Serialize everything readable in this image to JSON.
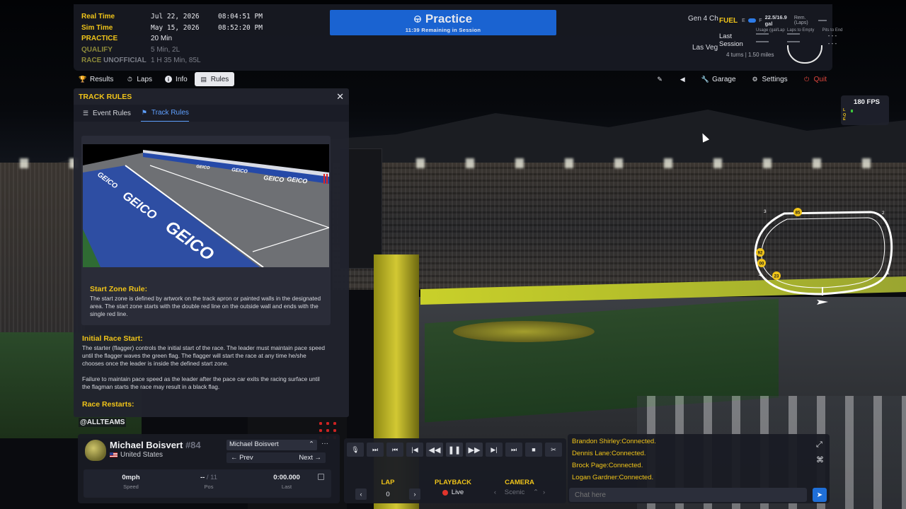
{
  "header": {
    "clock": [
      {
        "label": "Real Time",
        "date": "Jul 22, 2026",
        "time": "08:04:51 PM"
      },
      {
        "label": "Sim Time",
        "date": "May 15, 2026",
        "time": "08:52:20 PM"
      }
    ],
    "sessions": [
      {
        "label": "PRACTICE",
        "value": "20 Min"
      },
      {
        "label": "QUALIFY",
        "value": "5 Min, 2L"
      },
      {
        "label": "RACE",
        "tag": "UNOFFICIAL",
        "value": "1 H 35 Min, 85L"
      }
    ],
    "session_title": "Practice",
    "session_remaining": "11:39 Remaining in Session",
    "track_series": "Gen 4 Ch",
    "track_name": "Las Veg",
    "turns": "4 turns",
    "length": "1.50 miles",
    "fuel": {
      "label": "FUEL",
      "e": "E",
      "f": "F",
      "value": "22.5/16.9 gal",
      "rem_label": "Rem. (Laps)",
      "cols": [
        "Usage (gal/Lap",
        "Laps to Empty",
        "Pits to End"
      ],
      "rows": [
        {
          "name": "Last",
          "pits": "- - -"
        },
        {
          "name": "Session",
          "pits": "- - -"
        }
      ]
    }
  },
  "nav": {
    "left": [
      {
        "label": "Results",
        "icon": "trophy-icon"
      },
      {
        "label": "Laps",
        "icon": "stopwatch-icon"
      },
      {
        "label": "Info",
        "icon": "info-icon"
      },
      {
        "label": "Rules",
        "icon": "document-icon",
        "active": true
      }
    ],
    "right": {
      "garage": "Garage",
      "settings": "Settings",
      "quit": "Quit"
    }
  },
  "rules_panel": {
    "title": "TRACK RULES",
    "tabs": [
      "Event Rules",
      "Track Rules"
    ],
    "active_tab": "Track Rules",
    "image_signage": "GEICO",
    "start_zone": {
      "heading": "Start Zone Rule:",
      "text": "The start zone is defined by artwork on the track apron or painted walls in the designated area.  The start zone starts with the double red line on the outside wall and ends with the single red line."
    },
    "initial_start": {
      "heading": "Initial Race Start:",
      "text1": "The starter (flagger) controls the initial start of the race. The leader must maintain pace speed until the flagger waves the green flag. The flagger will start the race at any time he/she chooses once the leader is inside the defined start zone.",
      "text2": "Failure to maintain pace speed as the leader after the pace car exits the racing surface until the flagman starts the race may result in a black flag."
    },
    "restarts_heading": "Race Restarts:"
  },
  "team_tag": "@ALLTEAMS",
  "fps": {
    "value": "180 FPS",
    "lqe": [
      "L",
      "Q",
      "E"
    ]
  },
  "track_map": {
    "turns": [
      "1",
      "2",
      "3",
      "4"
    ],
    "cars": [
      "85",
      "92",
      "00",
      "23"
    ]
  },
  "driver": {
    "name": "Michael Boisvert",
    "number": "#84",
    "country": "United States",
    "select_value": "Michael Boisvert",
    "prev": "Prev",
    "next": "Next",
    "speed": "0mph",
    "speed_label": "Speed",
    "pos": "--",
    "pos_total": "/ 11",
    "pos_label": "Pos",
    "last": "0:00.000",
    "last_label": "Last"
  },
  "playback": {
    "lap_label": "LAP",
    "lap_value": "0",
    "playback_label": "PLAYBACK",
    "playback_value": "Live",
    "camera_label": "CAMERA",
    "camera_value": "Scenic"
  },
  "chat": {
    "messages": [
      "Brandon Shirley:Connected.",
      "Dennis Lane:Connected.",
      "Brock Page:Connected.",
      "Logan Gardner:Connected."
    ],
    "placeholder": "Chat here"
  },
  "colors": {
    "accent_yellow": "#f0c419",
    "session_blue": "#1a63d1",
    "quit_red": "#e3473e",
    "link_blue": "#5fa0ff"
  }
}
